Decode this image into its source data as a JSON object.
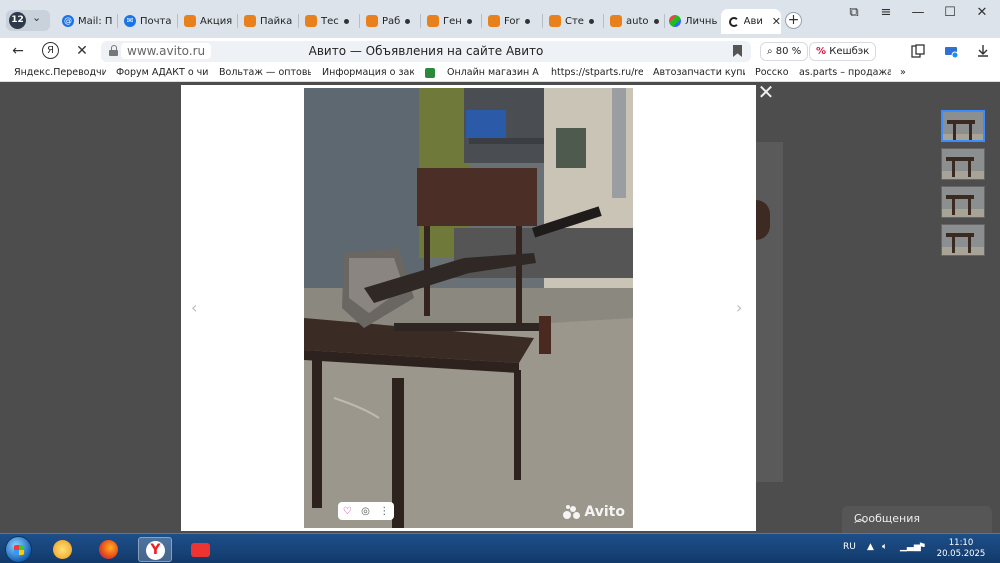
{
  "browser": {
    "tab_count": "12",
    "tabs": [
      {
        "label": "Mail: П",
        "icon": "mail-icon"
      },
      {
        "label": "Почта",
        "icon": "mail-icon"
      },
      {
        "label": "Акция",
        "icon": "avito-icon"
      },
      {
        "label": "Пайка",
        "icon": "avito-icon"
      },
      {
        "label": "Тес",
        "icon": "avito-icon"
      },
      {
        "label": "Раб",
        "icon": "avito-icon"
      },
      {
        "label": "Ген",
        "icon": "avito-icon"
      },
      {
        "label": "For",
        "icon": "avito-icon"
      },
      {
        "label": "Сте",
        "icon": "avito-icon"
      },
      {
        "label": "auto",
        "icon": "avito-icon"
      },
      {
        "label": "Личны",
        "icon": "lk-icon"
      },
      {
        "label": "Ави",
        "icon": "loading-icon"
      }
    ],
    "address": {
      "domain": "www.avito.ru",
      "page_title": "Авито — Объявления на сайте Авито"
    },
    "zoom": "80 %",
    "cashback": "Кешбэк",
    "bookmarks": [
      "Яндекс.Переводчик",
      "Форум АДАКТ о чи",
      "Вольтаж — оптовые",
      "Информация о зака",
      "Онлайн магазин AU",
      "https://stparts.ru/re",
      "Автозапчасти купит",
      "Росско",
      "as.parts – продажа г",
      "»"
    ]
  },
  "page": {
    "messages_panel": "Сообщения",
    "watermark": "Avito",
    "thumbnail_count": 4
  },
  "taskbar": {
    "lang": "RU",
    "time": "11:10",
    "date": "20.05.2025"
  },
  "colors": {
    "taskbar": "#1d4f8a",
    "tabstrip": "#dde3ea",
    "active_thumb": "#3b8cff",
    "avito_accent": "#e8801c"
  }
}
